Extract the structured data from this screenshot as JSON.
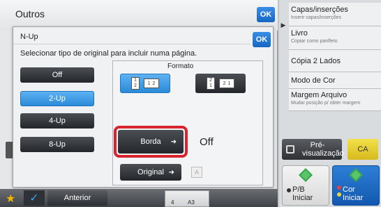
{
  "outer_window": {
    "title": "Outros",
    "ok_label": "OK"
  },
  "dialog": {
    "title": "N-Up",
    "ok_label": "OK",
    "instruction": "Selecionar tipo de original para incluir numa página.",
    "nup_options": [
      "Off",
      "2-Up",
      "4-Up",
      "8-Up"
    ],
    "selected_option": "2-Up",
    "format_label": "Formato",
    "format_option_a": {
      "pages": [
        "1",
        "2"
      ],
      "pages_side": [
        "1",
        "2"
      ]
    },
    "format_option_b": {
      "pages": [
        "2",
        "1"
      ],
      "pages_side": [
        "2",
        "1"
      ]
    },
    "border_label": "Borda",
    "border_value": "Off",
    "original_label": "Original",
    "orientation_icon": "A"
  },
  "right_panel": {
    "items": [
      {
        "title": "Capas/inserções",
        "subtitle": "Inserir capas/inserções"
      },
      {
        "title": "Livro",
        "subtitle": "Copiar como panfleto"
      },
      {
        "title": "Cópia 2 Lados",
        "subtitle": ""
      },
      {
        "title": "Modo de Cor",
        "subtitle": ""
      },
      {
        "title": "Margem Arquivo",
        "subtitle": "Mudar posição p/ obter margem"
      }
    ],
    "preview_label": "Pré-visualização",
    "ca_label": "CA",
    "start_bw_label_1": "P/B",
    "start_bw_label_2": "Iniciar",
    "start_color_label_1": "Cor",
    "start_color_label_2": "Iniciar"
  },
  "bottom_bar": {
    "back_label": "Anterior",
    "paper_count": "4",
    "paper_size": "A3"
  },
  "colors": {
    "accent_blue": "#2a8ad8",
    "highlight_red": "#d8242e",
    "ca_yellow": "#e6cc2a",
    "start_color_blue": "#1766c4",
    "star_color": "#f2b400"
  }
}
